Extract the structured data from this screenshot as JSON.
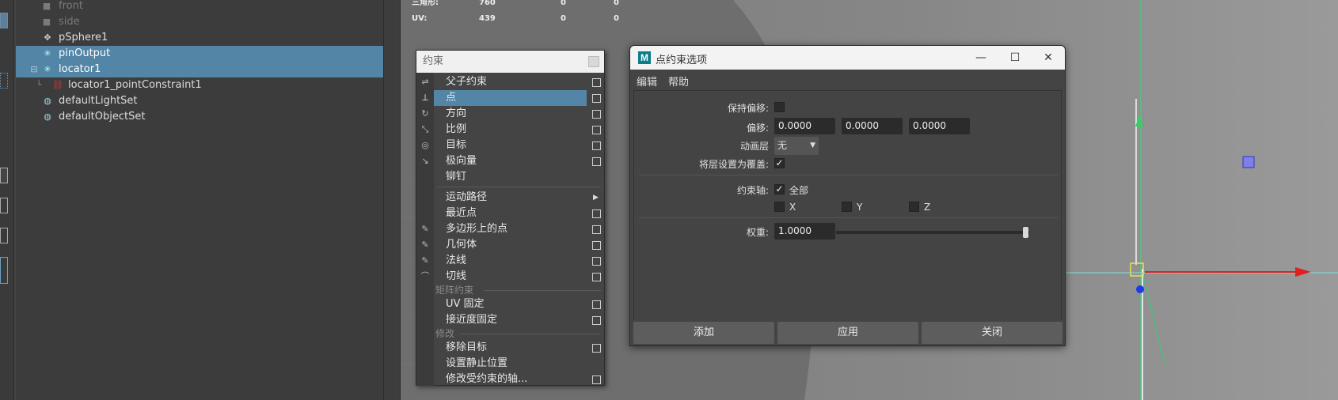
{
  "outliner": {
    "items": [
      {
        "label": "front",
        "dim": true
      },
      {
        "label": "side",
        "dim": true
      },
      {
        "label": "pSphere1"
      },
      {
        "label": "pinOutput",
        "selected": true
      },
      {
        "label": "locator1",
        "selected": true
      },
      {
        "label": "locator1_pointConstraint1"
      },
      {
        "label": "defaultLightSet"
      },
      {
        "label": "defaultObjectSet"
      }
    ]
  },
  "hud": {
    "rows": [
      {
        "label": "三角形:",
        "v1": "760",
        "v2": "0",
        "v3": "0"
      },
      {
        "label": "UV:",
        "v1": "439",
        "v2": "0",
        "v3": "0"
      }
    ]
  },
  "constrain_menu": {
    "title": "约束",
    "items": [
      {
        "label": "父子约束",
        "box": true
      },
      {
        "label": "点",
        "box": true,
        "highlighted": true
      },
      {
        "label": "方向",
        "box": true
      },
      {
        "label": "比例",
        "box": true
      },
      {
        "label": "目标",
        "box": true
      },
      {
        "label": "极向量",
        "box": true
      },
      {
        "label": "铆钉",
        "box": false
      },
      {
        "label": "运动路径",
        "submenu": true
      },
      {
        "label": "最近点",
        "box": true
      },
      {
        "label": "多边形上的点",
        "box": true
      },
      {
        "label": "几何体",
        "box": true
      },
      {
        "label": "法线",
        "box": true
      },
      {
        "label": "切线",
        "box": true
      },
      {
        "label": "UV 固定",
        "box": true
      },
      {
        "label": "接近度固定",
        "box": true
      },
      {
        "label": "移除目标",
        "box": true
      },
      {
        "label": "设置静止位置",
        "box": false
      },
      {
        "label": "修改受约束的轴...",
        "box": true
      }
    ],
    "section_matrix": "矩阵约束",
    "section_modify": "修改"
  },
  "dialog": {
    "title": "点约束选项",
    "menu": {
      "edit": "编辑",
      "help": "帮助"
    },
    "maintain_offset_label": "保持偏移:",
    "maintain_offset_checked": false,
    "offset_label": "偏移:",
    "offset": [
      "0.0000",
      "0.0000",
      "0.0000"
    ],
    "anim_layer_label": "动画层",
    "anim_layer_value": "无",
    "set_layer_override_label": "将层设置为覆盖:",
    "set_layer_override_checked": true,
    "constraint_axes_label": "约束轴:",
    "all_label": "全部",
    "all_checked": true,
    "x_label": "X",
    "y_label": "Y",
    "z_label": "Z",
    "weight_label": "权重:",
    "weight_value": "1.0000",
    "buttons": {
      "add": "添加",
      "apply": "应用",
      "close": "关闭"
    }
  }
}
